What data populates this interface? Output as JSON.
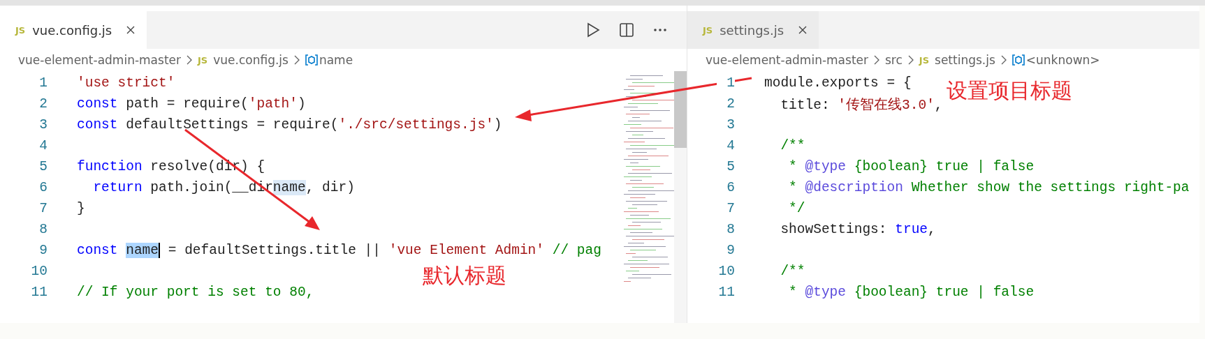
{
  "left_editor": {
    "tabs": [
      {
        "label": "vue.config.js",
        "badge": "JS",
        "selected": true
      }
    ],
    "breadcrumb": [
      {
        "text": "vue-element-admin-master",
        "kind": "folder"
      },
      {
        "text": "vue.config.js",
        "kind": "js",
        "badge": "JS"
      },
      {
        "text": "name",
        "kind": "symbol"
      }
    ],
    "lines": [
      {
        "number": "1",
        "tokens": [
          {
            "t": "'use strict'",
            "kind": "str"
          }
        ]
      },
      {
        "number": "2",
        "tokens": [
          {
            "t": "const",
            "kind": "kw"
          },
          {
            "t": " path = require(",
            "kind": "plain"
          },
          {
            "t": "'path'",
            "kind": "str"
          },
          {
            "t": ")",
            "kind": "plain"
          }
        ]
      },
      {
        "number": "3",
        "tokens": [
          {
            "t": "const",
            "kind": "kw"
          },
          {
            "t": " defaultSettings = require(",
            "kind": "plain"
          },
          {
            "t": "'./src/settings.js'",
            "kind": "str"
          },
          {
            "t": ")",
            "kind": "plain"
          }
        ]
      },
      {
        "number": "4"
      },
      {
        "number": "5",
        "tokens": [
          {
            "t": "function",
            "kind": "kw"
          },
          {
            "t": " resolve(dir) {",
            "kind": "plain"
          }
        ]
      },
      {
        "number": "6",
        "tokens": [
          {
            "t": "  return",
            "kind": "kw"
          },
          {
            "t": " path.join(__dir",
            "kind": "plain"
          },
          {
            "t": "name",
            "kind": "match"
          },
          {
            "t": ", dir)",
            "kind": "plain"
          }
        ]
      },
      {
        "number": "7",
        "tokens": [
          {
            "t": "}",
            "kind": "plain"
          }
        ]
      },
      {
        "number": "8"
      },
      {
        "number": "9",
        "tokens": [
          {
            "t": "const ",
            "kind": "kw"
          },
          {
            "t": "name",
            "kind": "sel"
          },
          {
            "t": " = defaultSettings.title || ",
            "kind": "plain"
          },
          {
            "t": "'vue Element Admin'",
            "kind": "str"
          },
          {
            "t": " // pag",
            "kind": "comment"
          }
        ]
      },
      {
        "number": "10"
      },
      {
        "number": "11",
        "tokens": [
          {
            "t": "// If your port is set to 80,",
            "kind": "comment"
          }
        ]
      }
    ]
  },
  "right_editor": {
    "tabs": [
      {
        "label": "settings.js",
        "badge": "JS",
        "selected": false
      }
    ],
    "breadcrumb": [
      {
        "text": "vue-element-admin-master",
        "kind": "folder"
      },
      {
        "text": "src",
        "kind": "folder"
      },
      {
        "text": "settings.js",
        "kind": "js",
        "badge": "JS"
      },
      {
        "text": "<unknown>",
        "kind": "symbol"
      }
    ],
    "lines": [
      {
        "number": "1",
        "tokens": [
          {
            "t": "module.exports = {",
            "kind": "plain"
          }
        ]
      },
      {
        "number": "2",
        "tokens": [
          {
            "t": "  title: ",
            "kind": "plain"
          },
          {
            "t": "'传智在线3.0'",
            "kind": "str"
          },
          {
            "t": ",",
            "kind": "plain"
          }
        ]
      },
      {
        "number": "3"
      },
      {
        "number": "4",
        "tokens": [
          {
            "t": "  /**",
            "kind": "comment"
          }
        ]
      },
      {
        "number": "5",
        "tokens": [
          {
            "t": "   * ",
            "kind": "comment"
          },
          {
            "t": "@type",
            "kind": "doctag"
          },
          {
            "t": " {boolean} true | false",
            "kind": "comment"
          }
        ]
      },
      {
        "number": "6",
        "tokens": [
          {
            "t": "   * ",
            "kind": "comment"
          },
          {
            "t": "@description",
            "kind": "doctag"
          },
          {
            "t": " Whether show the settings right-pa",
            "kind": "comment"
          }
        ]
      },
      {
        "number": "7",
        "tokens": [
          {
            "t": "   */",
            "kind": "comment"
          }
        ]
      },
      {
        "number": "8",
        "tokens": [
          {
            "t": "  showSettings: ",
            "kind": "plain"
          },
          {
            "t": "true",
            "kind": "kw"
          },
          {
            "t": ",",
            "kind": "plain"
          }
        ]
      },
      {
        "number": "9"
      },
      {
        "number": "10",
        "tokens": [
          {
            "t": "  /**",
            "kind": "comment"
          }
        ]
      },
      {
        "number": "11",
        "tokens": [
          {
            "t": "   * ",
            "kind": "comment"
          },
          {
            "t": "@type",
            "kind": "doctag"
          },
          {
            "t": " {boolean} true | false",
            "kind": "comment"
          }
        ]
      }
    ]
  },
  "annotations": [
    {
      "text": "设置项目标题",
      "kind": "label"
    },
    {
      "text": "默认标题",
      "kind": "label"
    }
  ]
}
